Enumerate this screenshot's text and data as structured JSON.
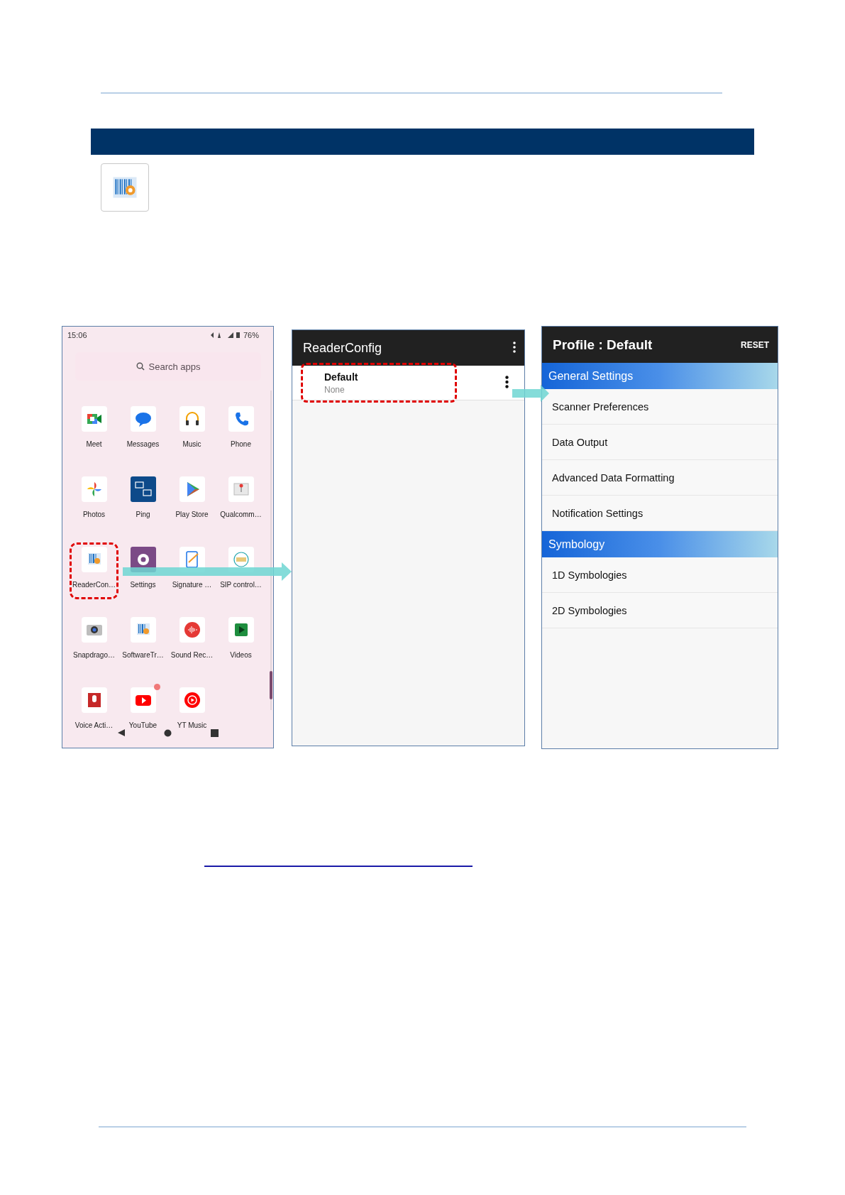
{
  "launcher": {
    "status_bar": {
      "time": "15:06",
      "battery": "76%"
    },
    "search": {
      "placeholder": "Search apps"
    },
    "apps": [
      {
        "label": "Meet",
        "highlighted": false,
        "badge": false
      },
      {
        "label": "Messages",
        "highlighted": false,
        "badge": false
      },
      {
        "label": "Music",
        "highlighted": false,
        "badge": false
      },
      {
        "label": "Phone",
        "highlighted": false,
        "badge": false
      },
      {
        "label": "Photos",
        "highlighted": false,
        "badge": false
      },
      {
        "label": "Ping",
        "highlighted": false,
        "badge": false
      },
      {
        "label": "Play Store",
        "highlighted": false,
        "badge": false
      },
      {
        "label": "Qualcomm…",
        "highlighted": false,
        "badge": false
      },
      {
        "label": "ReaderCon…",
        "highlighted": true,
        "badge": false
      },
      {
        "label": "Settings",
        "highlighted": false,
        "badge": false
      },
      {
        "label": "Signature …",
        "highlighted": false,
        "badge": false
      },
      {
        "label": "SIP control…",
        "highlighted": false,
        "badge": false
      },
      {
        "label": "Snapdrago…",
        "highlighted": false,
        "badge": false
      },
      {
        "label": "SoftwareTr…",
        "highlighted": false,
        "badge": false
      },
      {
        "label": "Sound Rec…",
        "highlighted": false,
        "badge": false
      },
      {
        "label": "Videos",
        "highlighted": false,
        "badge": false
      },
      {
        "label": "Voice Acti…",
        "highlighted": false,
        "badge": false
      },
      {
        "label": "YouTube",
        "highlighted": false,
        "badge": true
      },
      {
        "label": "YT Music",
        "highlighted": false,
        "badge": false
      }
    ]
  },
  "reader_config": {
    "title": "ReaderConfig",
    "profiles": [
      {
        "name": "Default",
        "detail": "None",
        "highlighted": true
      }
    ]
  },
  "profile": {
    "title": "Profile : Default",
    "action": "RESET",
    "entries": [
      {
        "kind": "header",
        "label": "General Settings"
      },
      {
        "kind": "item",
        "label": "Scanner Preferences"
      },
      {
        "kind": "item",
        "label": "Data Output"
      },
      {
        "kind": "item",
        "label": "Advanced Data Formatting"
      },
      {
        "kind": "item",
        "label": "Notification Settings"
      },
      {
        "kind": "header",
        "label": "Symbology"
      },
      {
        "kind": "item",
        "label": "1D Symbologies"
      },
      {
        "kind": "item",
        "label": "2D Symbologies"
      }
    ]
  }
}
